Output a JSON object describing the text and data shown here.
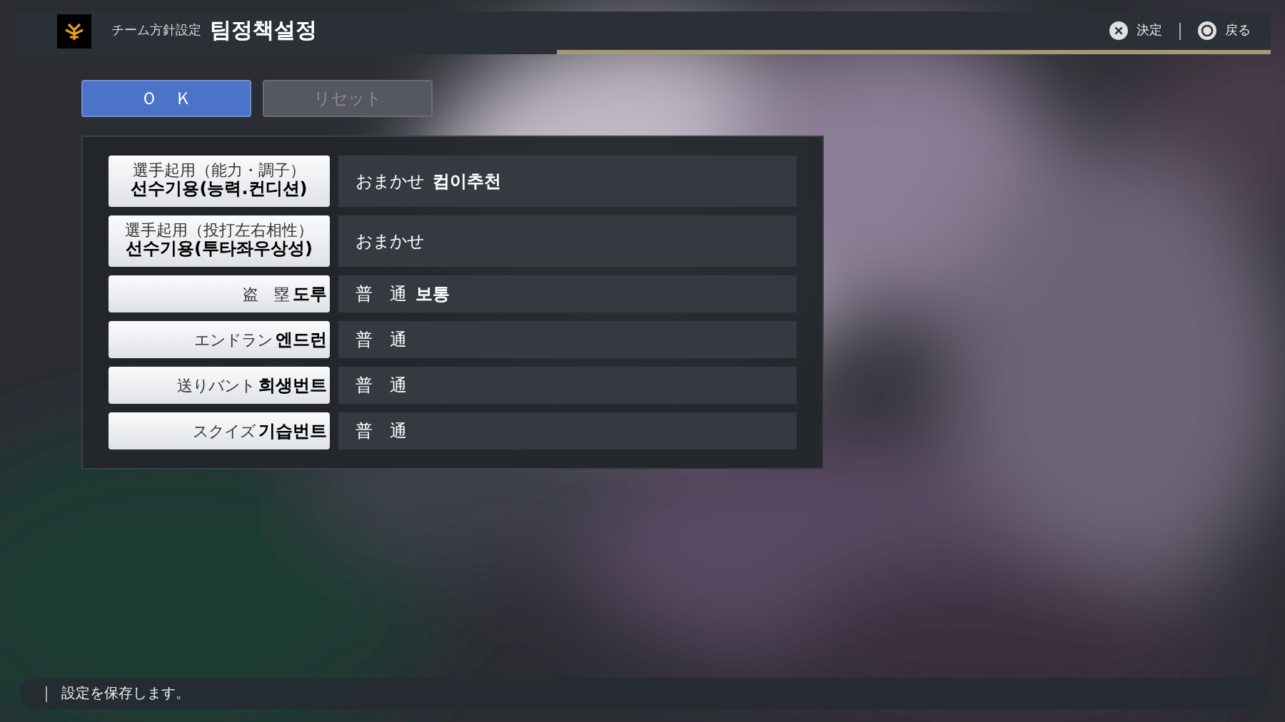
{
  "header": {
    "subtitle": "チーム方針設定",
    "title": "팀정책설정",
    "actions": [
      {
        "kind": "cross",
        "label": "決定"
      },
      {
        "kind": "circle",
        "label": "戻る"
      }
    ]
  },
  "buttons": [
    {
      "label": "Ｏ　Ｋ",
      "selected": true,
      "disabled": false
    },
    {
      "label": "リセット",
      "selected": false,
      "disabled": true
    }
  ],
  "settings": [
    {
      "kind": "stacked",
      "label": "選手起用（能力・調子）",
      "label_ko": "선수기용(능력.컨디션)",
      "value": "おまかせ",
      "value_ko": "컴이추천"
    },
    {
      "kind": "stacked",
      "label": "選手起用（投打左右相性）",
      "label_ko": "선수기용(투타좌우상성)",
      "value": "おまかせ"
    },
    {
      "kind": "inline",
      "label": "盗　塁",
      "label_ko": "도루",
      "value": "普　通",
      "value_ko": "보통"
    },
    {
      "kind": "inline",
      "label": "エンドラン",
      "label_ko": "엔드런",
      "value": "普　通"
    },
    {
      "kind": "inline",
      "label": "送りバント",
      "label_ko": "희생번트",
      "value": "普　通"
    },
    {
      "kind": "inline",
      "label": "スクイズ",
      "label_ko": "기습번트",
      "value": "普　通"
    }
  ],
  "status_bar": {
    "message": "設定を保存します。"
  }
}
